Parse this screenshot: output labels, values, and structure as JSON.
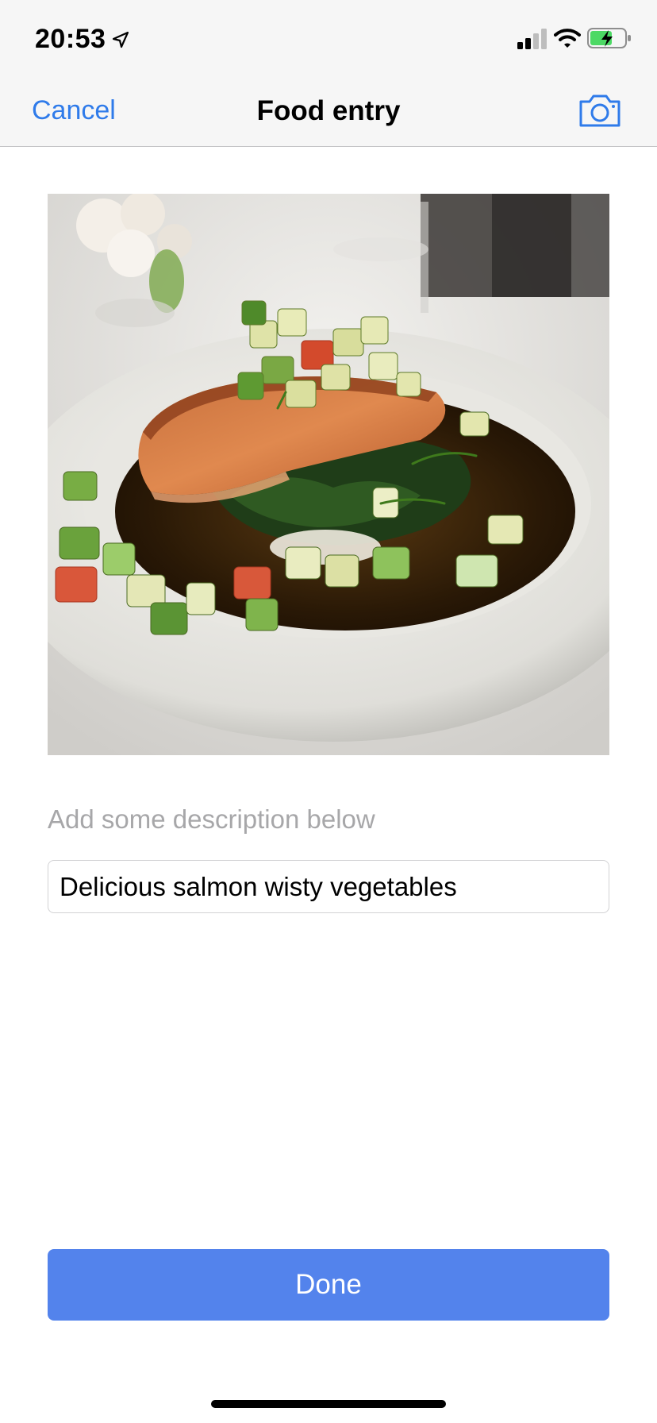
{
  "status_bar": {
    "time": "20:53",
    "icons": [
      "location-arrow-icon",
      "cellular-signal-icon",
      "wifi-icon",
      "battery-charging-icon"
    ],
    "battery_color": "#4cd964"
  },
  "nav": {
    "cancel_label": "Cancel",
    "title": "Food entry",
    "camera_icon": "camera-icon"
  },
  "photo": {
    "subject": "plated salmon with spinach and diced vegetables"
  },
  "form": {
    "description_label": "Add some description below",
    "description_value": "Delicious salmon wisty vegetables"
  },
  "actions": {
    "done_label": "Done"
  },
  "colors": {
    "accent": "#2f7bea",
    "button": "#5383ec",
    "bar_background": "#f6f6f6"
  }
}
